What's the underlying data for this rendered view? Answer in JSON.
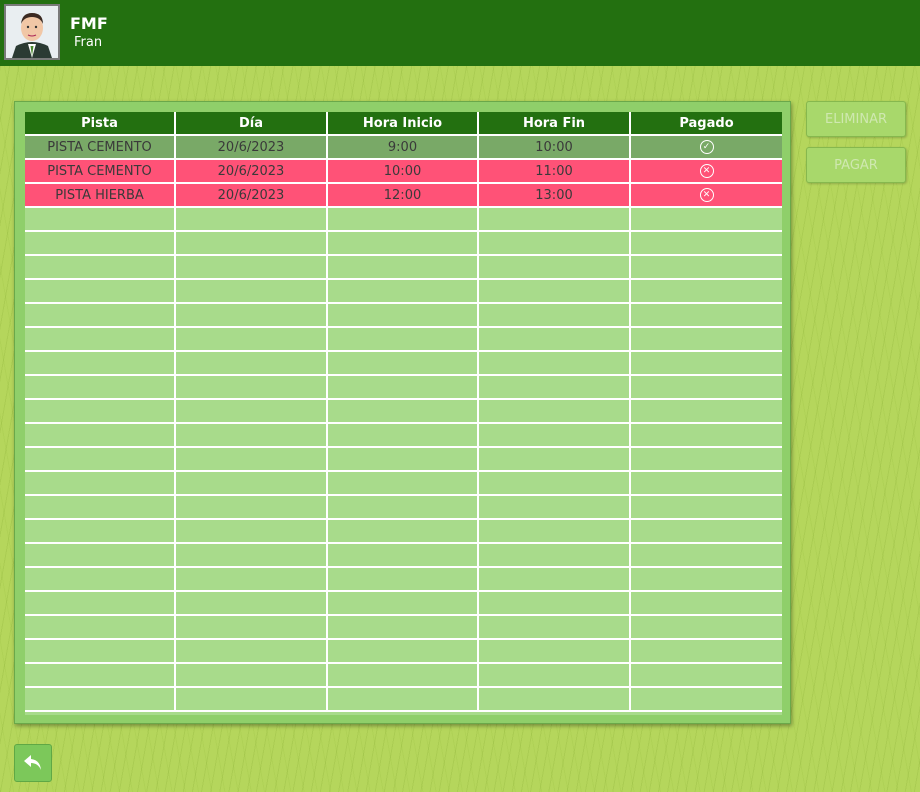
{
  "header": {
    "app_title": "FMF",
    "user_name": "Fran",
    "color": "#237010"
  },
  "table": {
    "columns": [
      "Pista",
      "Día",
      "Hora Inicio",
      "Hora Fin",
      "Pagado"
    ],
    "rows": [
      {
        "pista": "PISTA CEMENTO",
        "dia": "20/6/2023",
        "inicio": "9:00",
        "fin": "10:00",
        "pagado": "check-icon",
        "status_color": "#79a967"
      },
      {
        "pista": "PISTA CEMENTO",
        "dia": "20/6/2023",
        "inicio": "10:00",
        "fin": "11:00",
        "pagado": "x-icon",
        "status_color": "#ff5277"
      },
      {
        "pista": "PISTA HIERBA",
        "dia": "20/6/2023",
        "inicio": "12:00",
        "fin": "13:00",
        "pagado": "x-icon",
        "status_color": "#ff5277"
      }
    ]
  },
  "actions": {
    "delete_label": "ELIMINAR",
    "pay_label": "PAGAR",
    "back_icon": "back-arrow-icon"
  }
}
